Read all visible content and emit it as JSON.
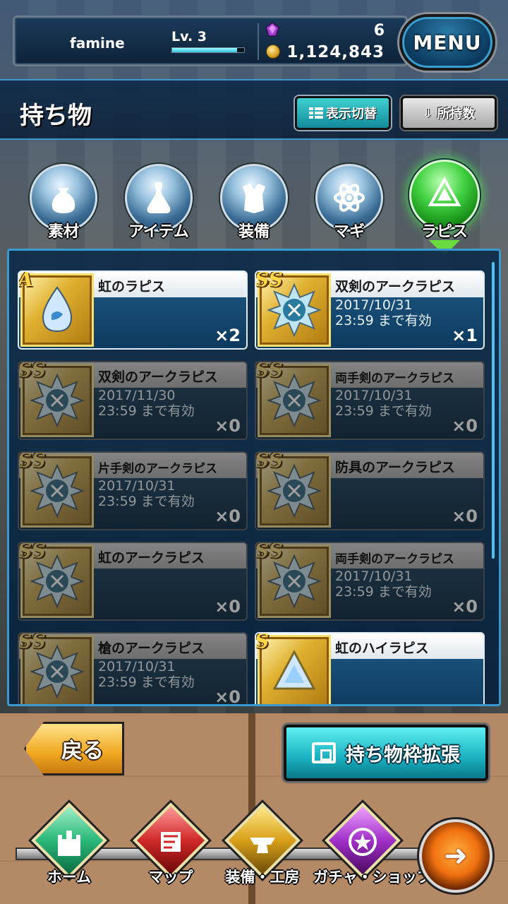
{
  "player": {
    "name": "famine",
    "level_label": "Lv. 3",
    "exp_fraction": 0.9
  },
  "currency": {
    "gems": "6",
    "gold": "1,124,843"
  },
  "menu_label": "MENU",
  "header": {
    "title": "持ち物",
    "view_toggle_label": "表示切替",
    "sort_label": "所持数"
  },
  "tabs": [
    {
      "label": "素材",
      "icon": "bag-icon"
    },
    {
      "label": "アイテム",
      "icon": "potion-icon"
    },
    {
      "label": "装備",
      "icon": "armor-icon"
    },
    {
      "label": "マギ",
      "icon": "atom-icon"
    },
    {
      "label": "ラピス",
      "icon": "lapis-icon",
      "active": true
    }
  ],
  "items": [
    {
      "rank": "A",
      "name": "虹のラピス",
      "expiry": "",
      "qty": "×2"
    },
    {
      "rank": "SS",
      "name": "双剣のアークラピス",
      "expiry": "2017/10/31\n23:59 まで有効",
      "qty": "×1"
    },
    {
      "rank": "SS",
      "name": "双剣のアークラピス",
      "expiry": "2017/11/30\n23:59 まで有効",
      "qty": "×0"
    },
    {
      "rank": "SS",
      "name": "両手剣のアークラピス",
      "expiry": "2017/10/31\n23:59 まで有効",
      "qty": "×0"
    },
    {
      "rank": "SS",
      "name": "片手剣のアークラピス",
      "expiry": "2017/10/31\n23:59 まで有効",
      "qty": "×0"
    },
    {
      "rank": "SS",
      "name": "防具のアークラピス",
      "expiry": "",
      "qty": "×0"
    },
    {
      "rank": "SS",
      "name": "虹のアークラピス",
      "expiry": "",
      "qty": "×0"
    },
    {
      "rank": "SS",
      "name": "両手剣のアークラピス",
      "expiry": "2017/10/31\n23:59 まで有効",
      "qty": "×0"
    },
    {
      "rank": "SS",
      "name": "槍のアークラピス",
      "expiry": "2017/10/31\n23:59 まで有効",
      "qty": "×0"
    },
    {
      "rank": "S",
      "name": "虹のハイラピス",
      "expiry": "",
      "qty": ""
    }
  ],
  "actions": {
    "back_label": "戻る",
    "expand_label": "持ち物枠拡張"
  },
  "nav": [
    {
      "label": "ホーム",
      "icon": "castle-icon",
      "color": "#2ab878"
    },
    {
      "label": "マップ",
      "icon": "map-icon",
      "color": "#d02828"
    },
    {
      "label": "装備・工房",
      "icon": "anvil-icon",
      "color": "#d8a018"
    },
    {
      "label": "ガチャ・ショップ",
      "icon": "star-circle-icon",
      "color": "#a030c8"
    }
  ],
  "colors": {
    "accent": "#3a9ad0",
    "active_tab": "#40d040",
    "gold": "#e0b030"
  }
}
